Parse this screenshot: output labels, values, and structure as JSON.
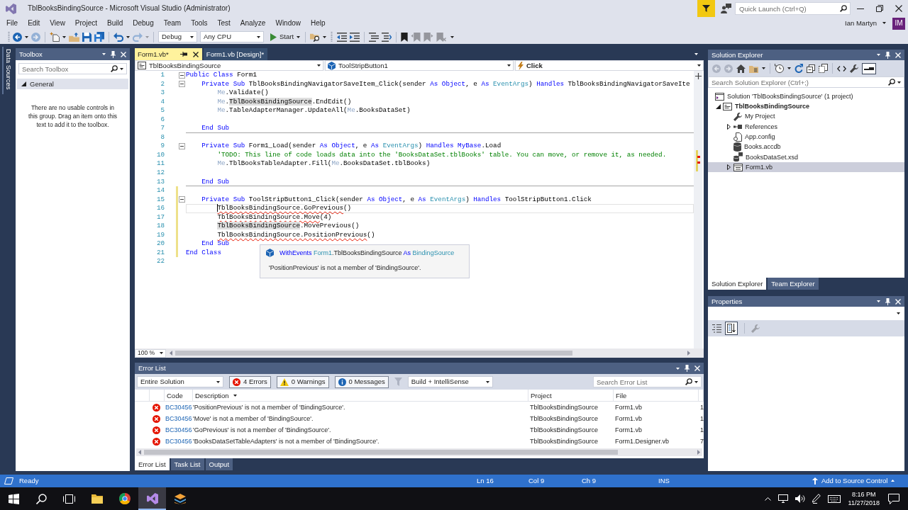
{
  "window": {
    "title": "TblBooksBindingSource - Microsoft Visual Studio  (Administrator)",
    "quick_launch": {
      "placeholder": "Quick Launch (Ctrl+Q)"
    }
  },
  "menu": [
    "File",
    "Edit",
    "View",
    "Project",
    "Build",
    "Debug",
    "Team",
    "Tools",
    "Test",
    "Analyze",
    "Window",
    "Help"
  ],
  "account": {
    "name": "Ian Martyn",
    "initials": "IM"
  },
  "toolbar": [
    {
      "kind": "back",
      "disabled": false
    },
    {
      "kind": "forward",
      "disabled": true
    },
    {
      "kind": "new",
      "disabled": false
    },
    {
      "kind": "open",
      "disabled": false
    },
    {
      "kind": "save",
      "disabled": false
    },
    {
      "kind": "save-all",
      "disabled": false
    },
    {
      "kind": "undo",
      "disabled": false
    },
    {
      "kind": "redo",
      "disabled": true
    },
    {
      "kind": "combo",
      "value": "Debug",
      "disabled": false
    },
    {
      "kind": "combo",
      "value": "Any CPU",
      "disabled": false
    },
    {
      "kind": "start",
      "label": "Start",
      "disabled": false
    },
    {
      "kind": "find",
      "disabled": false
    },
    {
      "kind": "outdent",
      "disabled": false
    },
    {
      "kind": "indent",
      "disabled": false
    },
    {
      "kind": "comment",
      "disabled": false
    },
    {
      "kind": "uncomment",
      "disabled": false
    },
    {
      "kind": "bookmark",
      "disabled": false
    },
    {
      "kind": "bookmark-prev",
      "disabled": true
    },
    {
      "kind": "bookmark-next",
      "disabled": true
    },
    {
      "kind": "bookmark-clear",
      "disabled": true
    }
  ],
  "side_tabs": [
    {
      "label": "Data Sources"
    }
  ],
  "toolbox": {
    "title": "Toolbox",
    "search": {
      "placeholder": "Search Toolbox"
    },
    "groups": [
      {
        "label": "General",
        "expanded": true,
        "message": "There are no usable controls in this group. Drag an item onto this text to add it to the toolbox."
      }
    ]
  },
  "editor": {
    "tabs": [
      {
        "label": "Form1.vb*",
        "selected": true
      },
      {
        "label": "Form1.vb [Design]*",
        "selected": false
      }
    ],
    "navigation": [
      {
        "kind": "class",
        "value": "TblBooksBindingSource"
      },
      {
        "kind": "member",
        "value": "ToolStripButton1"
      },
      {
        "kind": "event",
        "value": "Click"
      }
    ],
    "lines": [
      {
        "number": "1",
        "segments": [
          {
            "text": "Public Class",
            "kind": "keyword"
          },
          {
            "text": " Form1",
            "kind": "plain"
          }
        ],
        "fold": true,
        "modified": false,
        "separator": false,
        "current": false
      },
      {
        "number": "2",
        "segments": [
          {
            "text": "    Private Sub",
            "kind": "keyword"
          },
          {
            "text": " TblBooksBindingNavigatorSaveItem_Click(sender ",
            "kind": "plain"
          },
          {
            "text": "As Object",
            "kind": "keyword"
          },
          {
            "text": ", e ",
            "kind": "plain"
          },
          {
            "text": "As",
            "kind": "keyword"
          },
          {
            "text": " EventArgs",
            "kind": "type"
          },
          {
            "text": ") ",
            "kind": "plain"
          },
          {
            "text": "Handles",
            "kind": "keyword"
          },
          {
            "text": " TblBooksBindingNavigatorSaveIte",
            "kind": "plain"
          }
        ],
        "fold": true,
        "modified": false,
        "separator": false,
        "current": false
      },
      {
        "number": "3",
        "segments": [
          {
            "text": "        Me",
            "kind": "faded"
          },
          {
            "text": ".Validate()",
            "kind": "plain"
          }
        ],
        "fold": false,
        "modified": false,
        "separator": false,
        "current": false
      },
      {
        "number": "4",
        "segments": [
          {
            "text": "        Me",
            "kind": "faded"
          },
          {
            "text": ".",
            "kind": "plain"
          },
          {
            "text": "TblBooksBindingSource",
            "kind": "reference"
          },
          {
            "text": ".EndEdit()",
            "kind": "plain"
          }
        ],
        "fold": false,
        "modified": false,
        "separator": false,
        "current": false
      },
      {
        "number": "5",
        "segments": [
          {
            "text": "        Me",
            "kind": "faded"
          },
          {
            "text": ".TableAdapterManager.UpdateAll(",
            "kind": "plain"
          },
          {
            "text": "Me",
            "kind": "faded"
          },
          {
            "text": ".BooksDataSet)",
            "kind": "plain"
          }
        ],
        "fold": false,
        "modified": false,
        "separator": false,
        "current": false
      },
      {
        "number": "6",
        "fold": false,
        "modified": false,
        "separator": false,
        "current": false
      },
      {
        "number": "7",
        "segments": [
          {
            "text": "    End Sub",
            "kind": "keyword"
          }
        ],
        "fold": false,
        "modified": false,
        "separator": true,
        "current": false
      },
      {
        "number": "8",
        "fold": false,
        "modified": false,
        "separator": false,
        "current": false
      },
      {
        "number": "9",
        "segments": [
          {
            "text": "    Private Sub",
            "kind": "keyword"
          },
          {
            "text": " Form1_Load(sender ",
            "kind": "plain"
          },
          {
            "text": "As Object",
            "kind": "keyword"
          },
          {
            "text": ", e ",
            "kind": "plain"
          },
          {
            "text": "As",
            "kind": "keyword"
          },
          {
            "text": " EventArgs",
            "kind": "type"
          },
          {
            "text": ") ",
            "kind": "plain"
          },
          {
            "text": "Handles MyBase",
            "kind": "keyword"
          },
          {
            "text": ".Load",
            "kind": "plain"
          }
        ],
        "fold": true,
        "modified": false,
        "separator": false,
        "current": false
      },
      {
        "number": "10",
        "segments": [
          {
            "text": "        'TODO: This line of code loads data into the 'BooksDataSet.tblBooks' table. You can move, or remove it, as needed.",
            "kind": "comment"
          }
        ],
        "fold": false,
        "modified": false,
        "separator": false,
        "current": false
      },
      {
        "number": "11",
        "segments": [
          {
            "text": "        Me",
            "kind": "faded"
          },
          {
            "text": ".TblBooksTableAdapter.Fill(",
            "kind": "plain"
          },
          {
            "text": "Me",
            "kind": "faded"
          },
          {
            "text": ".BooksDataSet.tblBooks)",
            "kind": "plain"
          }
        ],
        "fold": false,
        "modified": false,
        "separator": false,
        "current": false
      },
      {
        "number": "12",
        "fold": false,
        "modified": false,
        "separator": false,
        "current": false
      },
      {
        "number": "13",
        "segments": [
          {
            "text": "    End Sub",
            "kind": "keyword"
          }
        ],
        "fold": false,
        "modified": false,
        "separator": true,
        "current": false
      },
      {
        "number": "14",
        "fold": false,
        "modified": true,
        "separator": false,
        "current": false
      },
      {
        "number": "15",
        "segments": [
          {
            "text": "    Private Sub",
            "kind": "keyword"
          },
          {
            "text": " ToolStripButton1_Click(sender ",
            "kind": "plain"
          },
          {
            "text": "As Object",
            "kind": "keyword"
          },
          {
            "text": ", e ",
            "kind": "plain"
          },
          {
            "text": "As",
            "kind": "keyword"
          },
          {
            "text": " EventArgs",
            "kind": "type"
          },
          {
            "text": ") ",
            "kind": "plain"
          },
          {
            "text": "Handles",
            "kind": "keyword"
          },
          {
            "text": " ToolStripButton1.Click",
            "kind": "plain"
          }
        ],
        "fold": true,
        "modified": true,
        "separator": false,
        "current": false
      },
      {
        "number": "16",
        "segments": [
          {
            "text": "        TblBooksBindingSource.GoPrevious",
            "kind": "error"
          },
          {
            "text": "()",
            "kind": "plain"
          }
        ],
        "fold": false,
        "modified": true,
        "separator": false,
        "current": true
      },
      {
        "number": "17",
        "segments": [
          {
            "text": "        TblBooksBindingSource.Move",
            "kind": "error"
          },
          {
            "text": "(4)",
            "kind": "plain"
          }
        ],
        "fold": false,
        "modified": true,
        "separator": false,
        "current": false
      },
      {
        "number": "18",
        "segments": [
          {
            "text": "        TblBooksBindingSource",
            "kind": "reference"
          },
          {
            "text": ".MovePrevious()",
            "kind": "plain"
          }
        ],
        "fold": false,
        "modified": true,
        "separator": false,
        "current": false
      },
      {
        "number": "19",
        "segments": [
          {
            "text": "        TblBooksBindingSource.PositionPrevious",
            "kind": "error"
          },
          {
            "text": "()",
            "kind": "plain"
          }
        ],
        "fold": false,
        "modified": true,
        "separator": false,
        "current": false
      },
      {
        "number": "20",
        "segments": [
          {
            "text": "    End Sub",
            "kind": "keyword"
          }
        ],
        "fold": false,
        "modified": true,
        "separator": false,
        "current": false
      },
      {
        "number": "21",
        "segments": [
          {
            "text": "End Class",
            "kind": "keyword"
          }
        ],
        "fold": false,
        "modified": true,
        "separator": false,
        "current": false
      },
      {
        "number": "22",
        "fold": false,
        "modified": false,
        "separator": false,
        "current": false
      }
    ],
    "quick_info": {
      "signature": [
        {
          "text": "WithEvents",
          "kind": "keyword"
        },
        {
          "text": " Form1",
          "kind": "type"
        },
        {
          "text": ".TblBooksBindingSource ",
          "kind": "plain"
        },
        {
          "text": "As",
          "kind": "keyword"
        },
        {
          "text": " BindingSource",
          "kind": "type"
        }
      ],
      "message": "'PositionPrevious' is not a member of 'BindingSource'."
    },
    "zoom": "100 %"
  },
  "error_list": {
    "title": "Error List",
    "scope": "Entire Solution",
    "filters": [
      {
        "kind": "error",
        "label": "4 Errors",
        "on": true
      },
      {
        "kind": "warning",
        "label": "0 Warnings",
        "on": true
      },
      {
        "kind": "message",
        "label": "0 Messages",
        "on": true
      }
    ],
    "filter_button": {
      "disabled": true
    },
    "source": "Build + IntelliSense",
    "search": {
      "placeholder": "Search Error List"
    },
    "columns": [
      {
        "label": "Code",
        "sorted": false
      },
      {
        "label": "Description",
        "sorted": true
      },
      {
        "label": "Project",
        "sorted": false
      },
      {
        "label": "File",
        "sorted": false
      }
    ],
    "rows": [
      {
        "kind": "error",
        "code": "BC30456",
        "description": "'PositionPrevious' is not a member of 'BindingSource'.",
        "project": "TblBooksBindingSource",
        "file": "Form1.vb",
        "column_6": "1"
      },
      {
        "kind": "error",
        "code": "BC30456",
        "description": "'Move' is not a member of 'BindingSource'.",
        "project": "TblBooksBindingSource",
        "file": "Form1.vb",
        "column_6": "1"
      },
      {
        "kind": "error",
        "code": "BC30456",
        "description": "'GoPrevious' is not a member of 'BindingSource'.",
        "project": "TblBooksBindingSource",
        "file": "Form1.vb",
        "column_6": "1"
      },
      {
        "kind": "error",
        "code": "BC30456",
        "description": "'BooksDataSetTableAdapters' is not a member of 'BindingSource'.",
        "project": "TblBooksBindingSource",
        "file": "Form1.Designer.vb",
        "column_6": "7"
      }
    ],
    "tabs": [
      {
        "label": "Error List",
        "selected": true
      },
      {
        "label": "Task List",
        "selected": false
      },
      {
        "label": "Output",
        "selected": false
      }
    ]
  },
  "solution_explorer": {
    "title": "Solution Explorer",
    "toolbar": [
      {
        "kind": "back",
        "disabled": true,
        "on": false
      },
      {
        "kind": "forward",
        "disabled": true,
        "on": false
      },
      {
        "kind": "home",
        "disabled": false,
        "on": false
      },
      {
        "kind": "switch-views",
        "disabled": false,
        "on": false
      },
      {
        "kind": "pending-changes",
        "disabled": false,
        "on": false
      },
      {
        "kind": "refresh",
        "disabled": false,
        "on": false
      },
      {
        "kind": "collapse-all",
        "disabled": false,
        "on": false
      },
      {
        "kind": "show-all-files",
        "disabled": false,
        "on": false
      },
      {
        "kind": "view-code",
        "disabled": false,
        "on": false
      },
      {
        "kind": "properties",
        "disabled": false,
        "on": false
      },
      {
        "kind": "preview",
        "disabled": false,
        "on": true
      }
    ],
    "search": {
      "placeholder": "Search Solution Explorer (Ctrl+;)"
    },
    "tree": [
      {
        "label": "Solution 'TblBooksBindingSource' (1 project)",
        "kind": "solution",
        "selected": false,
        "children": [
          {
            "label": "TblBooksBindingSource",
            "kind": "project",
            "expanded": true,
            "selected": false,
            "children": [
              {
                "label": "My Project",
                "kind": "settings",
                "selected": false
              },
              {
                "label": "References",
                "kind": "references",
                "expanded": false,
                "selected": false
              },
              {
                "label": "App.config",
                "kind": "config",
                "selected": false
              },
              {
                "label": "Books.accdb",
                "kind": "database",
                "selected": false
              },
              {
                "label": "BooksDataSet.xsd",
                "kind": "dataset",
                "selected": false
              },
              {
                "label": "Form1.vb",
                "kind": "form",
                "expanded": false,
                "selected": true
              }
            ]
          }
        ]
      }
    ],
    "tabs": [
      {
        "label": "Solution Explorer",
        "selected": true
      },
      {
        "label": "Team Explorer",
        "selected": false
      }
    ]
  },
  "properties": {
    "title": "Properties",
    "toolbar": [
      {
        "kind": "categorized",
        "on": false,
        "disabled": false
      },
      {
        "kind": "alphabetical",
        "on": true,
        "disabled": false
      },
      {
        "kind": "property-pages",
        "on": false,
        "disabled": true
      }
    ]
  },
  "status_bar": {
    "message": "Ready",
    "line": "Ln 16",
    "column": "Col 9",
    "character": "Ch 9",
    "mode": "INS",
    "source_control": "Add to Source Control"
  },
  "taskbar": {
    "items": [
      {
        "kind": "start",
        "active": false
      },
      {
        "kind": "search",
        "active": false
      },
      {
        "kind": "task-view",
        "active": false
      },
      {
        "kind": "files",
        "active": false
      },
      {
        "kind": "browser",
        "active": false
      },
      {
        "kind": "ide",
        "active": true
      },
      {
        "kind": "layers",
        "active": false
      }
    ],
    "time": "8:16 PM",
    "date": "11/27/2018"
  }
}
